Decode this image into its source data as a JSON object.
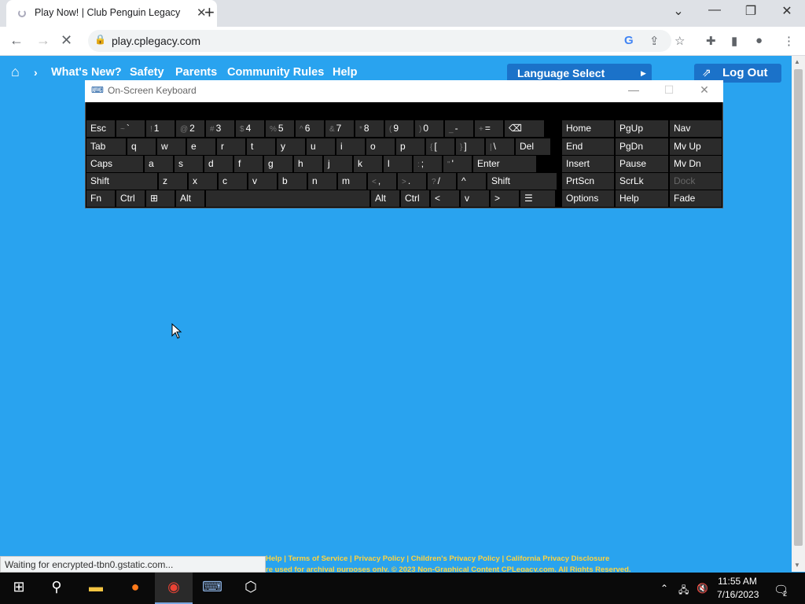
{
  "browser": {
    "tab_title": "Play Now! | Club Penguin Legacy",
    "url": "play.cplegacy.com",
    "status_text": "Waiting for encrypted-tbn0.gstatic.com..."
  },
  "site": {
    "nav": [
      "What's New?",
      "Safety",
      "Parents",
      "Community Rules",
      "Help"
    ],
    "language_button": "Language Select",
    "logout_button": "Log Out",
    "footer_line1": "Help | Terms of Service | Privacy Policy | Children's Privacy Policy | California Privacy Disclosure",
    "footer_line2": "re used for archival purposes only. © 2023 Non-Graphical Content CPLegacy.com. All Rights Reserved."
  },
  "osk": {
    "title": "On-Screen Keyboard",
    "rows": [
      [
        "Esc",
        "~ `",
        "! 1",
        "@ 2",
        "# 3",
        "$ 4",
        "% 5",
        "^ 6",
        "& 7",
        "* 8",
        "( 9",
        ") 0",
        "_ -",
        "+ =",
        "⌫"
      ],
      [
        "Tab",
        "q",
        "w",
        "e",
        "r",
        "t",
        "y",
        "u",
        "i",
        "o",
        "p",
        "{ [",
        "} ]",
        "| \\",
        "Del"
      ],
      [
        "Caps",
        "a",
        "s",
        "d",
        "f",
        "g",
        "h",
        "j",
        "k",
        "l",
        ": ;",
        "\" '",
        "Enter"
      ],
      [
        "Shift",
        "z",
        "x",
        "c",
        "v",
        "b",
        "n",
        "m",
        "< ,",
        "> .",
        "? /",
        "^",
        "Shift"
      ],
      [
        "Fn",
        "Ctrl",
        "⊞",
        "Alt",
        "",
        "Alt",
        "Ctrl",
        "<",
        "v",
        ">",
        "☰"
      ]
    ],
    "side_keys": [
      [
        "Home",
        "PgUp",
        "Nav"
      ],
      [
        "End",
        "PgDn",
        "Mv Up"
      ],
      [
        "Insert",
        "Pause",
        "Mv Dn"
      ],
      [
        "PrtScn",
        "ScrLk",
        "Dock"
      ],
      [
        "Options",
        "Help",
        "Fade"
      ]
    ]
  },
  "taskbar": {
    "time": "11:55 AM",
    "date": "7/16/2023",
    "notifications": "2"
  }
}
